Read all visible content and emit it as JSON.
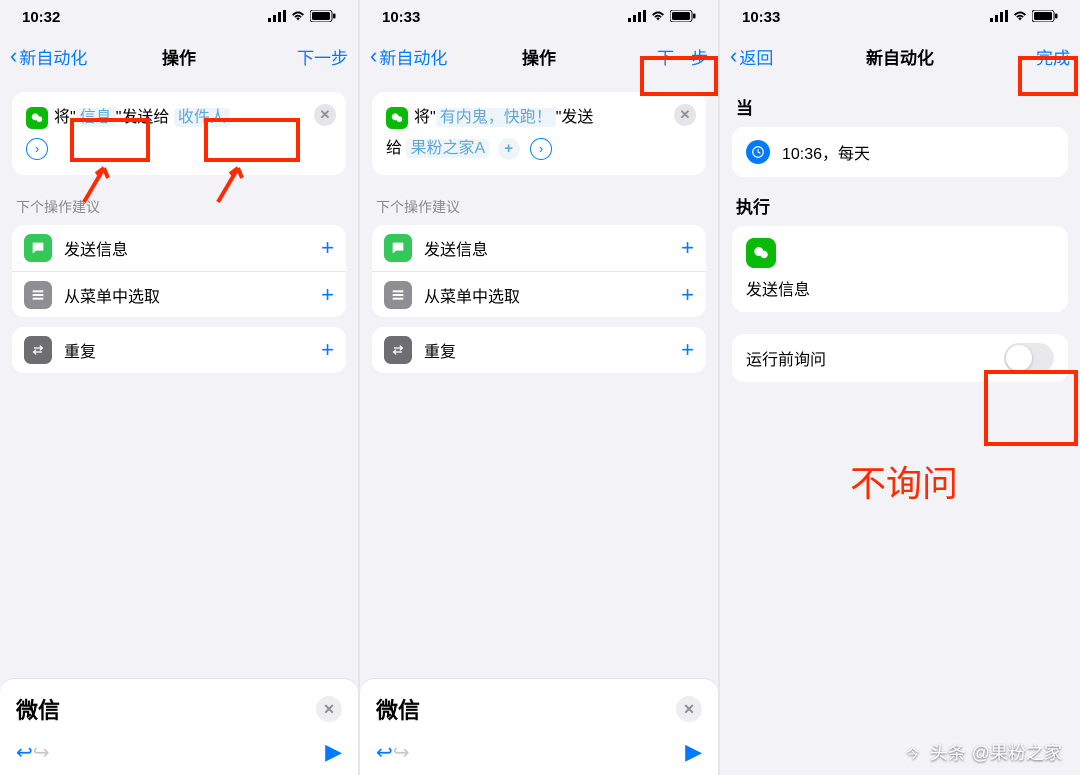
{
  "status": {
    "signal": "signal-icon",
    "wifi": "wifi-icon",
    "battery": "battery-icon"
  },
  "p1": {
    "time": "10:32",
    "nav": {
      "back": "新自动化",
      "title": "操作",
      "next": "下一步"
    },
    "card": {
      "pre": "将\"",
      "msg": "信息",
      "mid": "\"发送给",
      "rcpt": "收件人"
    },
    "suggest_label": "下个操作建议",
    "suggestions": [
      {
        "label": "发送信息",
        "icon": "message-icon"
      },
      {
        "label": "从菜单中选取",
        "icon": "menu-icon"
      },
      {
        "label": "重复",
        "icon": "repeat-icon"
      }
    ],
    "sheet": {
      "title": "微信"
    }
  },
  "p2": {
    "time": "10:33",
    "nav": {
      "back": "新自动化",
      "title": "操作",
      "next": "下一步"
    },
    "card": {
      "pre": "将\"",
      "msg": "有内鬼，快跑！",
      "mid": "\"发送",
      "line2_pre": "给",
      "rcpt": "果粉之家A",
      "plus": "+"
    },
    "suggest_label": "下个操作建议",
    "suggestions": [
      {
        "label": "发送信息",
        "icon": "message-icon"
      },
      {
        "label": "从菜单中选取",
        "icon": "menu-icon"
      },
      {
        "label": "重复",
        "icon": "repeat-icon"
      }
    ],
    "sheet": {
      "title": "微信"
    }
  },
  "p3": {
    "time": "10:33",
    "nav": {
      "back": "返回",
      "title": "新自动化",
      "done": "完成"
    },
    "when_head": "当",
    "when_text": "10:36，每天",
    "do_head": "执行",
    "do_text": "发送信息",
    "ask_label": "运行前询问",
    "annotation": "不询问"
  },
  "watermark": {
    "prefix": "头条",
    "handle": "@果粉之家"
  }
}
